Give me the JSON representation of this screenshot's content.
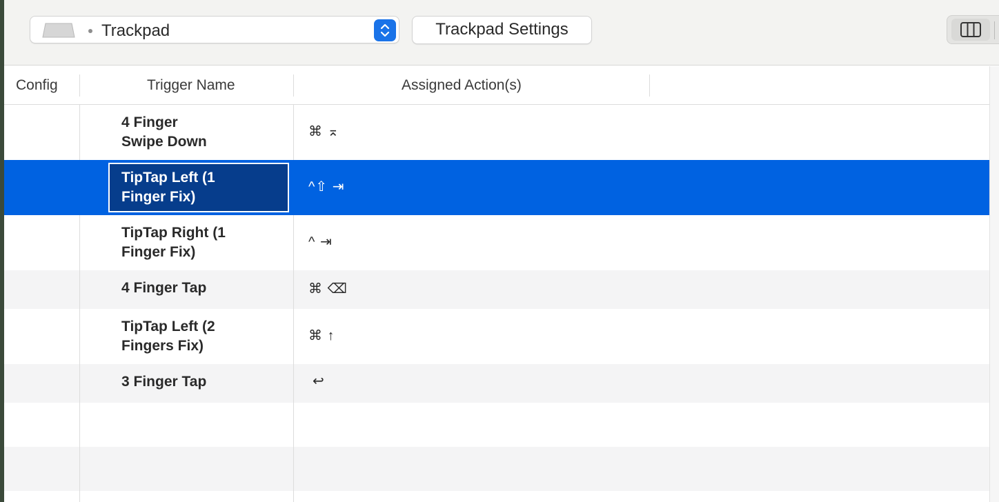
{
  "toolbar": {
    "device_label": "Trackpad",
    "settings_button_label": "Trackpad Settings"
  },
  "table": {
    "columns": [
      "Config",
      "Trigger Name",
      "Assigned Action(s)"
    ],
    "rows": [
      {
        "trigger_line1": "4 Finger",
        "trigger_line2": "Swipe Down",
        "action": "⌘ ⌅"
      },
      {
        "trigger_line1": "TipTap Left (1",
        "trigger_line2": "Finger Fix)",
        "action": "^⇧ ⇥"
      },
      {
        "trigger_line1": "TipTap Right (1",
        "trigger_line2": "Finger Fix)",
        "action": "^ ⇥"
      },
      {
        "trigger_line1": "4 Finger Tap",
        "trigger_line2": "",
        "action": "⌘ ⌫"
      },
      {
        "trigger_line1": "TipTap Left (2",
        "trigger_line2": "Fingers Fix)",
        "action": "⌘ ↑"
      },
      {
        "trigger_line1": "3 Finger Tap",
        "trigger_line2": "",
        "action": "↩"
      }
    ],
    "selected_row_index": 1
  },
  "colors": {
    "selection": "#0062e1",
    "stepper": "#1a73e8",
    "toolbar_bg": "#f3f3f1"
  },
  "icons": [
    "trackpad-icon",
    "updown-chevron-icon",
    "column-view-icon"
  ]
}
